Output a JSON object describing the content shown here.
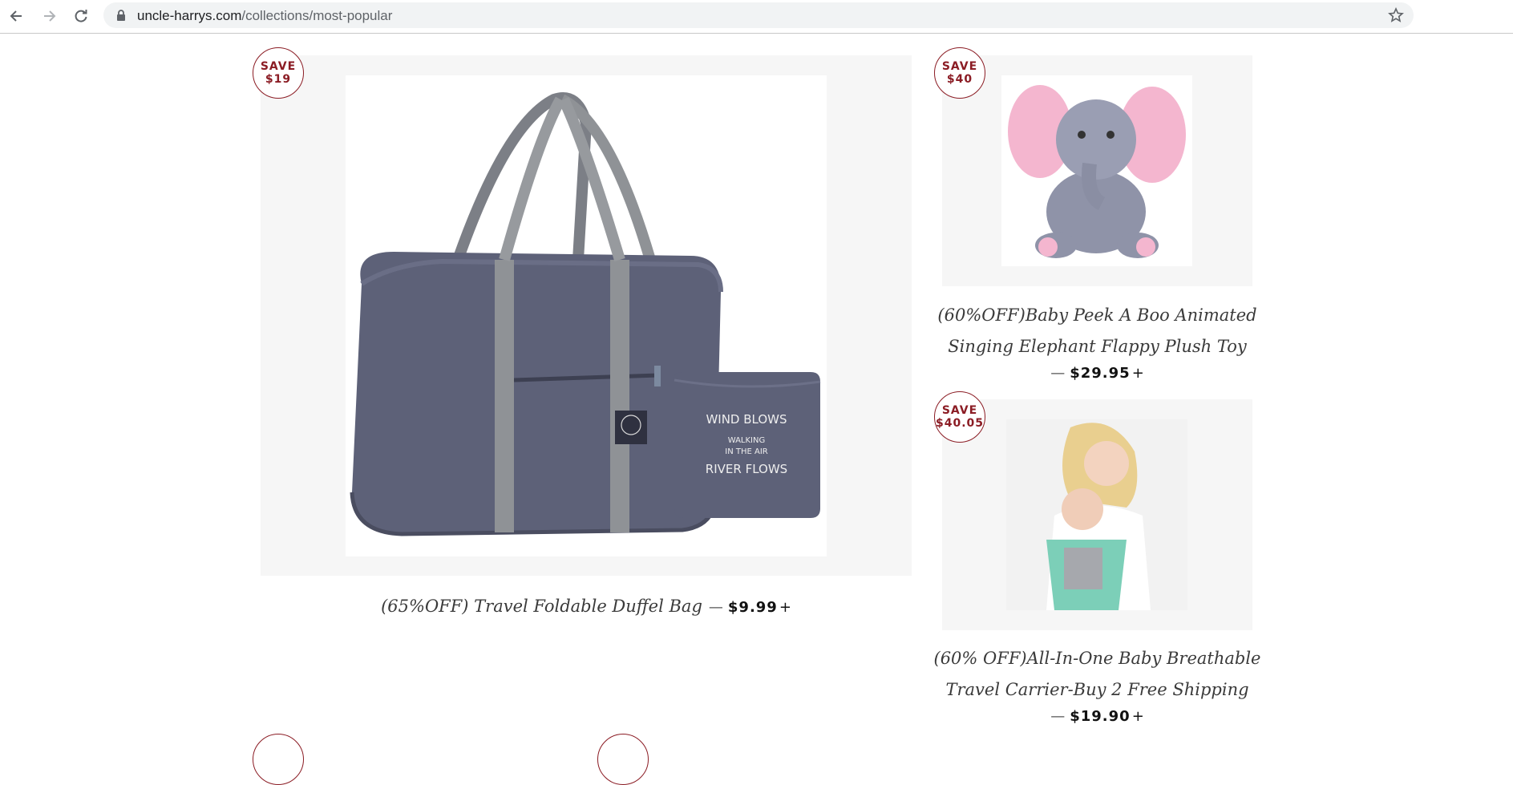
{
  "browser": {
    "url_host": "uncle-harrys.com",
    "url_path": "/collections/most-popular"
  },
  "products": [
    {
      "badge_line1": "SAVE",
      "badge_line2": "$19",
      "title": "(65%OFF) Travel Foldable Duffel Bag",
      "dash": "—",
      "price": "$9.99",
      "plus": "+",
      "pouch_text": [
        "WIND BLOWS",
        "WALKING",
        "IN THE AIR",
        "RIVER FLOWS"
      ]
    },
    {
      "badge_line1": "SAVE",
      "badge_line2": "$40",
      "title_line1": "(60%OFF)Baby Peek A Boo Animated",
      "title_line2": "Singing Elephant Flappy Plush Toy",
      "dash": "—",
      "price": "$29.95",
      "plus": "+"
    },
    {
      "badge_line1": "SAVE",
      "badge_line2": "$40.05",
      "title_line1": "(60% OFF)All-In-One Baby Breathable",
      "title_line2": "Travel Carrier-Buy 2 Free Shipping",
      "dash": "—",
      "price": "$19.90",
      "plus": "+"
    }
  ],
  "colors": {
    "badge": "#8b1c24",
    "card_bg": "#f6f6f6",
    "bag": "#5d6178",
    "strap": "#8f9296"
  },
  "icons": [
    "back-arrow-icon",
    "forward-arrow-icon",
    "reload-icon",
    "lock-icon",
    "bookmark-star-icon"
  ]
}
